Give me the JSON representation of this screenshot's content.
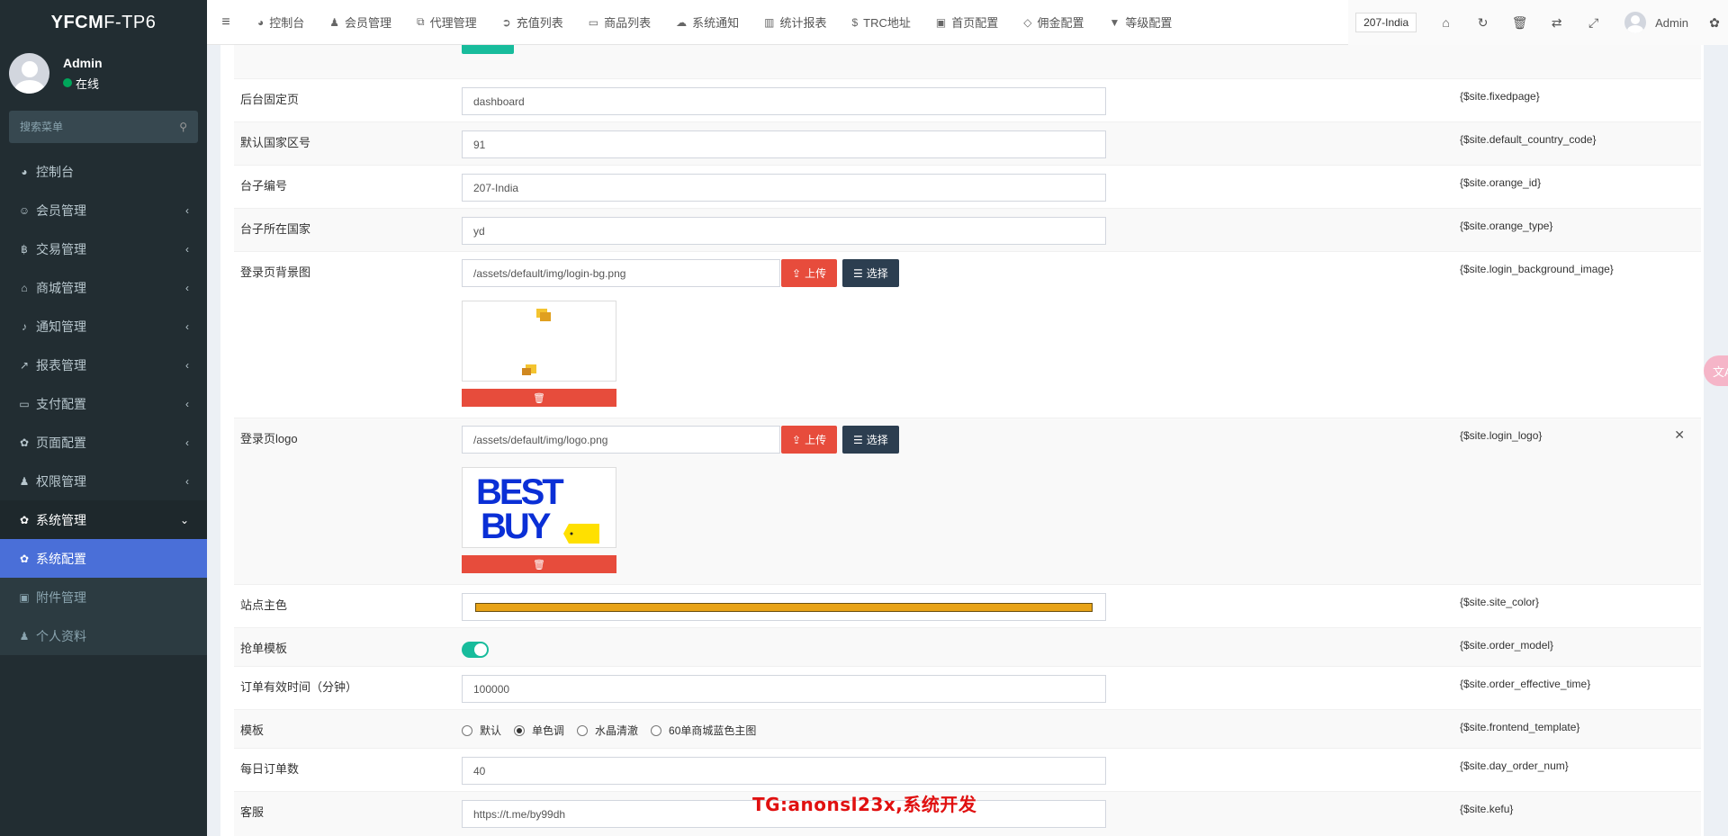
{
  "app": {
    "logo_bold": "YFCM",
    "logo_light": "F-TP6"
  },
  "user": {
    "name": "Admin",
    "status": "在线"
  },
  "sidebar": {
    "search_placeholder": "搜索菜单",
    "items": [
      {
        "label": "控制台",
        "icon": "dashboard-icon",
        "glyph": "◕"
      },
      {
        "label": "会员管理",
        "icon": "user-circle-icon",
        "glyph": "☺",
        "arrow": "‹"
      },
      {
        "label": "交易管理",
        "icon": "bitcoin-icon",
        "glyph": "฿",
        "arrow": "‹"
      },
      {
        "label": "商城管理",
        "icon": "home-icon",
        "glyph": "⌂",
        "arrow": "‹"
      },
      {
        "label": "通知管理",
        "icon": "bell-icon",
        "glyph": "♪",
        "arrow": "‹"
      },
      {
        "label": "报表管理",
        "icon": "line-chart-icon",
        "glyph": "↗",
        "arrow": "‹"
      },
      {
        "label": "支付配置",
        "icon": "credit-card-icon",
        "glyph": "▭",
        "arrow": "‹"
      },
      {
        "label": "页面配置",
        "icon": "gear-icon",
        "glyph": "✿",
        "arrow": "‹"
      },
      {
        "label": "权限管理",
        "icon": "users-icon",
        "glyph": "♟",
        "arrow": "‹"
      },
      {
        "label": "系统管理",
        "icon": "cogs-icon",
        "glyph": "✿",
        "arrow": "⌄"
      },
      {
        "label": "系统配置",
        "icon": "gear-icon",
        "glyph": "✿"
      },
      {
        "label": "附件管理",
        "icon": "file-image-icon",
        "glyph": "▣"
      },
      {
        "label": "个人资料",
        "icon": "user-icon",
        "glyph": "♟"
      }
    ]
  },
  "topnav": {
    "hamburger": "≡",
    "items": [
      {
        "label": "控制台",
        "glyph": "◕",
        "icon": "dashboard-icon"
      },
      {
        "label": "会员管理",
        "glyph": "♟",
        "icon": "user-icon"
      },
      {
        "label": "代理管理",
        "glyph": "⧉",
        "icon": "sitemap-icon"
      },
      {
        "label": "充值列表",
        "glyph": "➲",
        "icon": "sign-in-icon"
      },
      {
        "label": "商品列表",
        "glyph": "▭",
        "icon": "desktop-icon"
      },
      {
        "label": "系统通知",
        "glyph": "☁",
        "icon": "comments-icon"
      },
      {
        "label": "统计报表",
        "glyph": "▥",
        "icon": "bar-chart-icon"
      },
      {
        "label": "TRC地址",
        "glyph": "$",
        "icon": "dollar-icon"
      },
      {
        "label": "首页配置",
        "glyph": "▣",
        "icon": "save-icon"
      },
      {
        "label": "佣金配置",
        "glyph": "◇",
        "icon": "diamond-icon"
      },
      {
        "label": "等级配置",
        "glyph": "▼",
        "icon": "vimeo-icon"
      }
    ],
    "country": "207-India",
    "right_icons": [
      {
        "glyph": "⌂",
        "icon": "home-icon"
      },
      {
        "glyph": "↻",
        "icon": "refresh-icon"
      },
      {
        "glyph": "🗑",
        "icon": "trash-icon"
      },
      {
        "glyph": "⇄",
        "icon": "translate-icon"
      },
      {
        "glyph": "⤢",
        "icon": "fullscreen-icon"
      }
    ],
    "user": "Admin",
    "settings_glyph": "✿"
  },
  "form": {
    "fixedpage": {
      "label": "后台固定页",
      "value": "dashboard",
      "var": "{$site.fixedpage}"
    },
    "country_code": {
      "label": "默认国家区号",
      "value": "91",
      "var": "{$site.default_country_code}"
    },
    "orange_id": {
      "label": "台子编号",
      "value": "207-India",
      "var": "{$site.orange_id}"
    },
    "orange_type": {
      "label": "台子所在国家",
      "value": "yd",
      "var": "{$site.orange_type}"
    },
    "login_bg": {
      "label": "登录页背景图",
      "value": "/assets/default/img/login-bg.png",
      "var": "{$site.login_background_image}",
      "upload": "上传",
      "choose": "选择",
      "delete_glyph": "🗑"
    },
    "login_logo": {
      "label": "登录页logo",
      "value": "/assets/default/img/logo.png",
      "var": "{$site.login_logo}",
      "upload": "上传",
      "choose": "选择",
      "delete_glyph": "🗑",
      "close_glyph": "✕",
      "logo_line1": "BEST",
      "logo_line2": "BUY"
    },
    "site_color": {
      "label": "站点主色",
      "var": "{$site.site_color}",
      "color": "#e8a317"
    },
    "order_model": {
      "label": "抢单模板",
      "var": "{$site.order_model}",
      "enabled": true
    },
    "order_time": {
      "label": "订单有效时间（分钟）",
      "value": "100000",
      "var": "{$site.order_effective_time}"
    },
    "template": {
      "label": "模板",
      "var": "{$site.frontend_template}",
      "options": [
        "默认",
        "单色调",
        "水晶清澈",
        "60单商城蓝色主图"
      ],
      "selected": 1
    },
    "day_order": {
      "label": "每日订单数",
      "value": "40",
      "var": "{$site.day_order_num}"
    },
    "kefu": {
      "label": "客服",
      "value": "https://t.me/by99dh",
      "var": "{$site.kefu}"
    }
  },
  "watermark": "TG:anonsl23x,系统开发",
  "colors": {
    "sidebar": "#222d32",
    "active": "#4a6fd8",
    "red": "#e74c3c",
    "dark": "#2c3e50",
    "teal": "#18bc9c"
  }
}
